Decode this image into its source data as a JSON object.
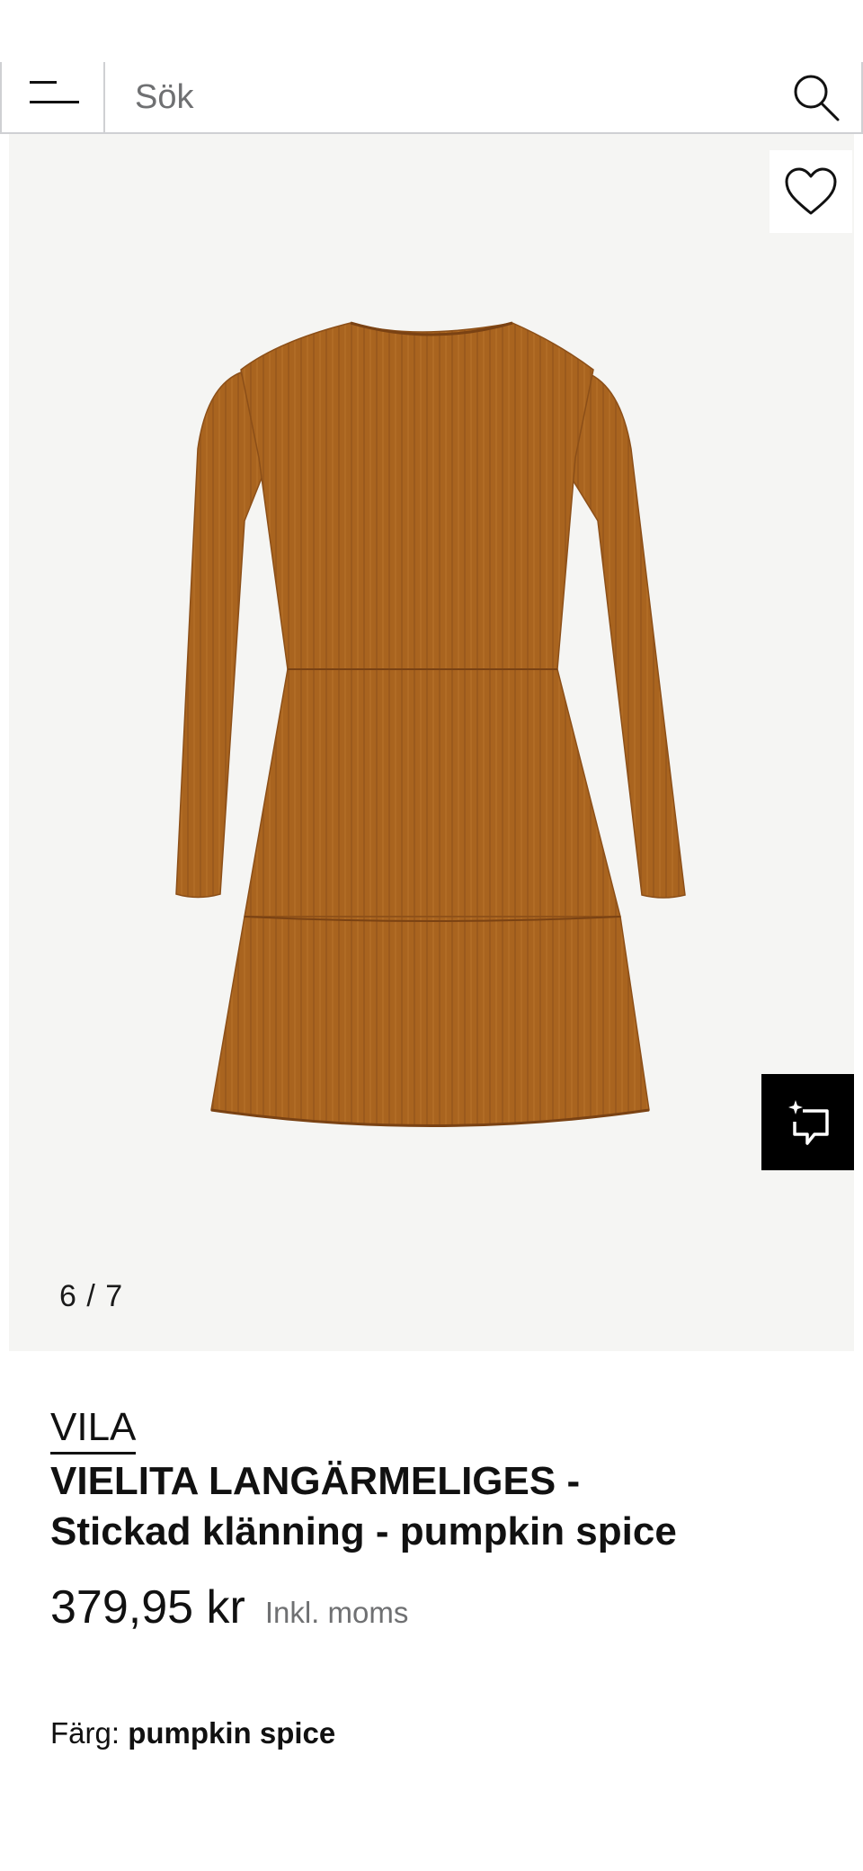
{
  "search": {
    "placeholder": "Sök",
    "menu_icon": "menu-icon",
    "search_icon": "search-icon"
  },
  "gallery": {
    "counter": "6 / 7",
    "wishlist_icon": "heart-icon",
    "feedback_icon": "feedback-icon",
    "product_color_hex": "#a9641f",
    "background_hex": "#f5f5f3"
  },
  "product": {
    "brand": "VILA",
    "title_line1": "VIELITA LANGÄRMELIGES -",
    "title_line2": "Stickad klänning - pumpkin spice",
    "price": "379,95 kr",
    "vat_note": "Inkl. moms",
    "color_label": "Färg:",
    "color_value": "pumpkin spice"
  }
}
